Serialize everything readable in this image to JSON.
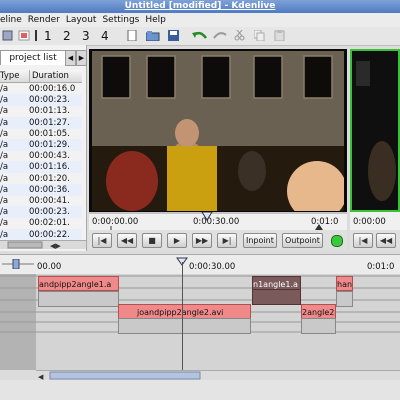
{
  "window": {
    "title": "Untitled [modified] - Kdenlive"
  },
  "menu": [
    "eline",
    "Render",
    "Layout",
    "Settings",
    "Help"
  ],
  "toolbar": {
    "numbers": [
      "1",
      "2",
      "3",
      "4"
    ]
  },
  "project_panel": {
    "tab_label": "project list",
    "columns": [
      "Type",
      "Duration"
    ],
    "rows": [
      {
        "type": "/a",
        "duration": "00:00:16.0"
      },
      {
        "type": "/a",
        "duration": "00:00:23."
      },
      {
        "type": "/a",
        "duration": "00:01:13."
      },
      {
        "type": "/a",
        "duration": "00:01:27."
      },
      {
        "type": "/a",
        "duration": "00:01:05."
      },
      {
        "type": "/a",
        "duration": "00:01:29."
      },
      {
        "type": "/a",
        "duration": "00:00:43."
      },
      {
        "type": "/a",
        "duration": "00:01:16."
      },
      {
        "type": "/a",
        "duration": "00:01:20."
      },
      {
        "type": "/a",
        "duration": "00:00:36."
      },
      {
        "type": "/a",
        "duration": "00:00:41."
      },
      {
        "type": "/a",
        "duration": "00:00:23."
      },
      {
        "type": "/a",
        "duration": "00:02:01."
      },
      {
        "type": "/a",
        "duration": "00:00:22."
      }
    ]
  },
  "monitor1": {
    "ruler_labels": [
      "0:00:00.00",
      "0:00:30.00",
      "0:01:0"
    ],
    "buttons": [
      "Inpoint",
      "Outpoint"
    ]
  },
  "monitor2": {
    "ruler_label": "0:00:00"
  },
  "timeline": {
    "ruler_labels": [
      "00.00",
      "0:00:30.00",
      "0:01:0"
    ],
    "track1_clips": [
      "andpipp2angle1.a",
      "n1angle1.a",
      "han"
    ],
    "track2_clips": [
      "joandpipp2angle2.avi",
      "2angle2.a"
    ]
  },
  "colors": {
    "clip_red": "#f08a8a",
    "active_monitor_border": "#38c238",
    "titlebar": "#4f79c2"
  }
}
